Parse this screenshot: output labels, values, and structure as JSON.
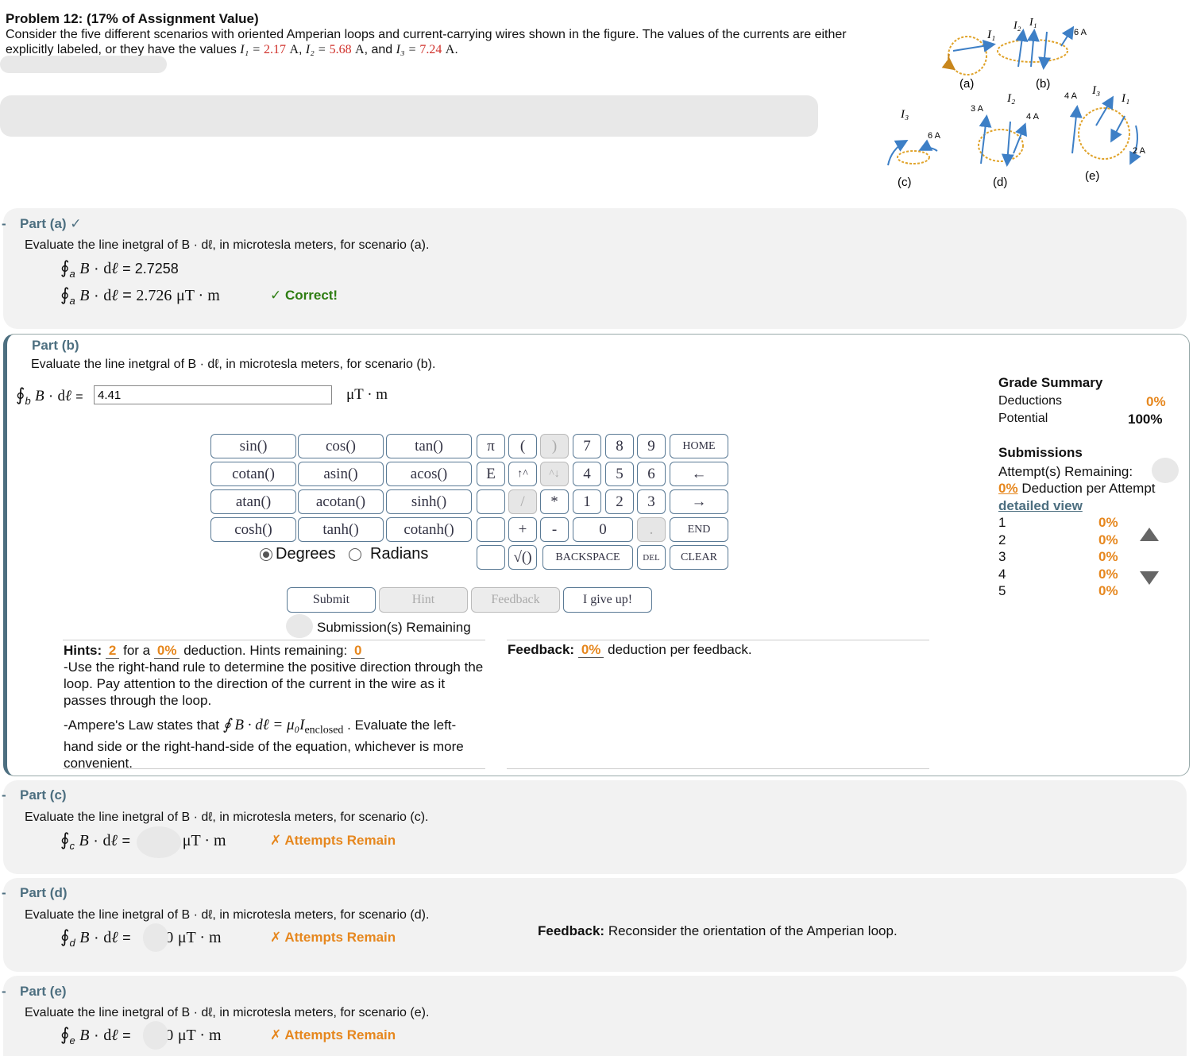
{
  "problem": {
    "title": "Problem 12: (17% of Assignment Value)",
    "text_part1": "Consider the five different scenarios with oriented Amperian loops and current-carrying wires shown in the figure. The values of the currents are either explicitly labeled, or they have the values",
    "I1_label": "I₁ = ",
    "I1_value": "2.17",
    "I2_label": "I₂ = ",
    "I2_value": "5.68",
    "I3_label": "I₃ = ",
    "I3_value": "7.24",
    "unit_A": "A",
    "and": "and"
  },
  "figure": {
    "labels": [
      "(a)",
      "(b)",
      "(c)",
      "(d)",
      "(e)"
    ],
    "currents": [
      "6 A",
      "6 A",
      "3 A",
      "4 A",
      "4 A",
      "2 A"
    ],
    "symbols": [
      "I₁",
      "I₂",
      "I₁",
      "I₃",
      "I₂",
      "I₃",
      "I₁"
    ]
  },
  "parts": {
    "a": {
      "title": "Part (a) ✓",
      "question": "Evaluate the line inetgral of B · dℓ, in microtesla meters, for scenario (a).",
      "integral_sub": "a",
      "entered": "2.7258",
      "result": "2.726",
      "unit": "μT · m",
      "status": "✓ Correct!"
    },
    "b": {
      "title": "Part (b)",
      "question": "Evaluate the line inetgral of B · dℓ, in microtesla meters, for scenario (b).",
      "integral_sub": "b",
      "input_value": "4.41",
      "unit": "μT · m"
    },
    "c": {
      "title": "Part (c)",
      "question": "Evaluate the line inetgral of B · dℓ, in microtesla meters, for scenario (c).",
      "integral_sub": "c",
      "result": ")",
      "unit": "μT · m",
      "status": "✗ Attempts Remain"
    },
    "d": {
      "title": "Part (d)",
      "question": "Evaluate the line inetgral of B · dℓ, in microtesla meters, for scenario (d).",
      "integral_sub": "d",
      "result": "00",
      "unit": "μT · m",
      "status": "✗ Attempts Remain",
      "feedback_label": "Feedback:",
      "feedback_text": "Reconsider the orientation of the Amperian loop."
    },
    "e": {
      "title": "Part (e)",
      "question": "Evaluate the line inetgral of B · dℓ, in microtesla meters, for scenario (e).",
      "integral_sub": "e",
      "result": "10",
      "unit": "μT · m",
      "status": "✗ Attempts Remain"
    }
  },
  "keypad": {
    "functions": [
      [
        "sin()",
        "cos()",
        "tan()"
      ],
      [
        "cotan()",
        "asin()",
        "acos()"
      ],
      [
        "atan()",
        "acotan()",
        "sinh()"
      ],
      [
        "cosh()",
        "tanh()",
        "cotanh()"
      ]
    ],
    "symbols": {
      "pi": "π",
      "lparen": "(",
      "rparen": ")",
      "E": "E",
      "up": "↑^",
      "down": "^↓",
      "slash": "/",
      "star": "*",
      "plus": "+",
      "minus": "-",
      "sqrt": "√()",
      "dot": "."
    },
    "digits": [
      "7",
      "8",
      "9",
      "4",
      "5",
      "6",
      "1",
      "2",
      "3",
      "0"
    ],
    "nav": {
      "home": "HOME",
      "left": "←",
      "right": "→",
      "end": "END",
      "backspace": "BACKSPACE",
      "del": "DEL",
      "clear": "CLEAR"
    },
    "degrees": "Degrees",
    "radians": "Radians",
    "angle_mode": "Degrees"
  },
  "actions": {
    "submit": "Submit",
    "hint": "Hint",
    "feedback": "Feedback",
    "give_up": "I give up!",
    "submissions_remaining": "Submission(s) Remaining"
  },
  "hints": {
    "label": "Hints:",
    "count": "2",
    "for_a": "for a",
    "deduction_pct": "0%",
    "deduction_text": "deduction. Hints remaining:",
    "remaining": "0",
    "hint1": "-Use the right-hand rule to determine the positive direction through the loop. Pay attention to the direction of the current in the wire as it passes through the loop.",
    "hint2_prefix": "-Ampere's Law states that",
    "hint2_equation": "∮ B · dℓ = μ₀I",
    "hint2_sub": "enclosed",
    "hint2_suffix": ". Evaluate the left-hand side or the right-hand-side of the equation, whichever is more convenient."
  },
  "feedback_box": {
    "label": "Feedback:",
    "pct": "0%",
    "text": "deduction per feedback."
  },
  "grade_summary": {
    "title": "Grade Summary",
    "deductions_label": "Deductions",
    "deductions_value": "0%",
    "potential_label": "Potential",
    "potential_value": "100%",
    "submissions_title": "Submissions",
    "attempts_label": "Attempt(s) Remaining:",
    "per_attempt_pct": "0%",
    "per_attempt_text": "Deduction per Attempt",
    "detailed_view": "detailed view",
    "rows": [
      {
        "n": "1",
        "v": "0%"
      },
      {
        "n": "2",
        "v": "0%"
      },
      {
        "n": "3",
        "v": "0%"
      },
      {
        "n": "4",
        "v": "0%"
      },
      {
        "n": "5",
        "v": "0%"
      }
    ]
  }
}
